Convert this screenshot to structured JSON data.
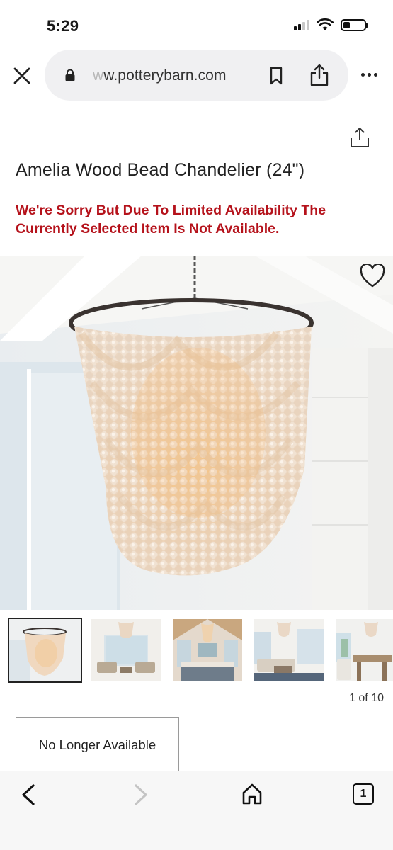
{
  "status_bar": {
    "time": "5:29",
    "icons": [
      "signal-icon",
      "wifi-icon",
      "battery-icon"
    ]
  },
  "browser": {
    "url_faded_prefix": "w",
    "url": "w.potterybarn.com",
    "icons": [
      "close-icon",
      "lock-icon",
      "bookmark-icon",
      "share-icon",
      "more-icon"
    ]
  },
  "product": {
    "title": "Amelia Wood Bead Chandelier (24\")",
    "availability_message": "We're Sorry But Due To Limited Availability The Currently Selected Item Is Not Available.",
    "status_button": "No Longer Available"
  },
  "gallery": {
    "counter": "1 of 10",
    "thumbnail_count_visible": 5,
    "selected_index": 0
  },
  "toolbar": {
    "tab_count": "1",
    "icons": [
      "back-arrow-icon",
      "forward-arrow-icon",
      "home-icon",
      "tabs-icon"
    ]
  },
  "colors": {
    "alert_red": "#b5121b",
    "url_bar_bg": "#f0f0f2",
    "toolbar_bg": "#f7f7f7"
  }
}
